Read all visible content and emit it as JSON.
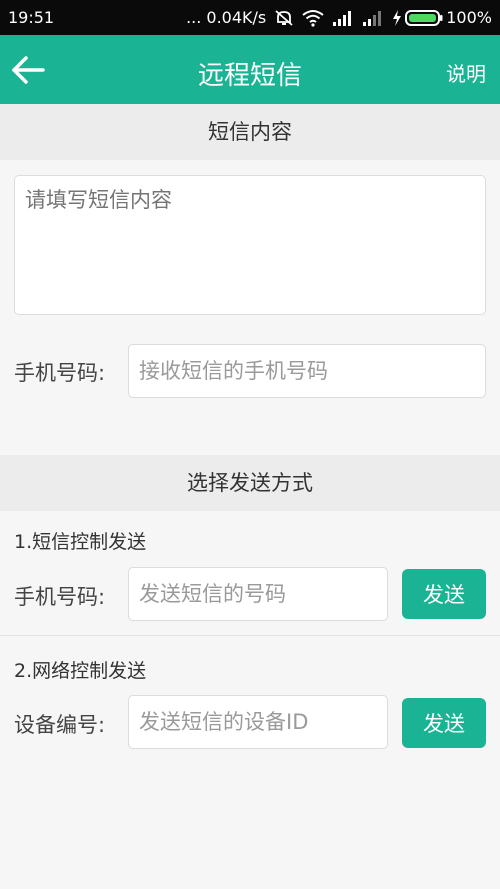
{
  "status_bar": {
    "time": "19:51",
    "network_speed": "... 0.04K/s",
    "battery": "100%"
  },
  "app_bar": {
    "title": "远程短信",
    "help_label": "说明"
  },
  "content_section": {
    "header": "短信内容",
    "message_placeholder": "请填写短信内容",
    "phone_label": "手机号码:",
    "phone_placeholder": "接收短信的手机号码"
  },
  "method_section": {
    "header": "选择发送方式",
    "sms_control": {
      "title": "1.短信控制发送",
      "label": "手机号码:",
      "placeholder": "发送短信的号码",
      "button": "发送"
    },
    "network_control": {
      "title": "2.网络控制发送",
      "label": "设备编号:",
      "placeholder": "发送短信的设备ID",
      "button": "发送"
    }
  },
  "colors": {
    "accent": "#1ab394",
    "status_bar": "#0a0a0a",
    "section_header_bg": "#ececec",
    "page_bg": "#f6f6f6"
  },
  "icons": [
    "back-arrow-icon",
    "mute-icon",
    "wifi-icon",
    "signal-icon",
    "charging-icon",
    "battery-icon"
  ]
}
